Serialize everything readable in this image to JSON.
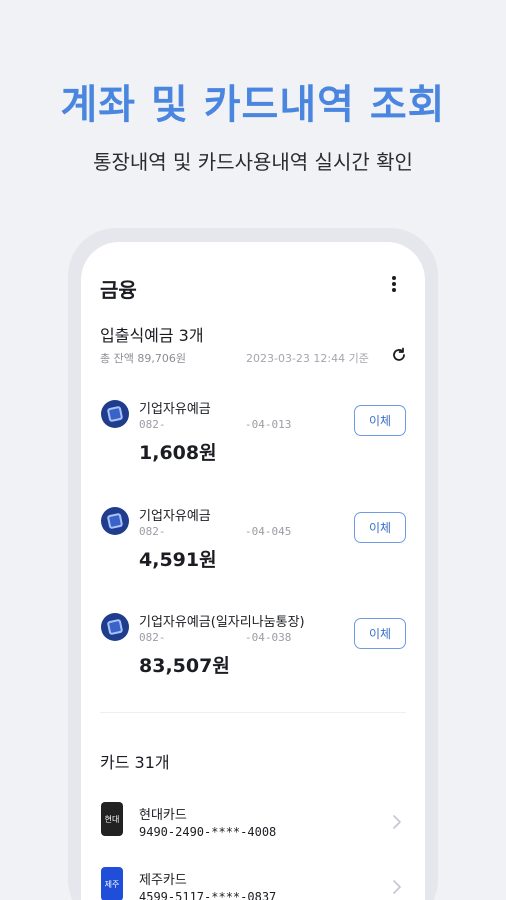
{
  "banner": {
    "headline": "계좌 및 카드내역 조회",
    "subline": "통장내역 및 카드사용내역 실시간 확인"
  },
  "screen": {
    "title": "금융",
    "deposits": {
      "title": "입출식예금 3개",
      "total": "총 잔액 89,706원",
      "updated": "2023-03-23 12:44 기준",
      "accounts": [
        {
          "name": "기업자유예금",
          "number": "082-            -04-013",
          "balance": "1,608원",
          "action": "이체"
        },
        {
          "name": "기업자유예금",
          "number": "082-            -04-045",
          "balance": "4,591원",
          "action": "이체"
        },
        {
          "name": "기업자유예금(일자리나눔통장)",
          "number": "082-            -04-038",
          "balance": "83,507원",
          "action": "이체"
        }
      ]
    },
    "cards": {
      "title": "카드 31개",
      "items": [
        {
          "name": "현대카드",
          "number": "9490-2490-****-4008",
          "badge": "현대",
          "color": "#222222"
        },
        {
          "name": "제주카드",
          "number": "4599-5117-****-0837",
          "badge": "제주",
          "color": "#1f4fd8"
        }
      ]
    }
  },
  "colors": {
    "accent": "#4a86e0",
    "button_border": "#6f9be2",
    "bank_icon": "#1f3d8c"
  }
}
